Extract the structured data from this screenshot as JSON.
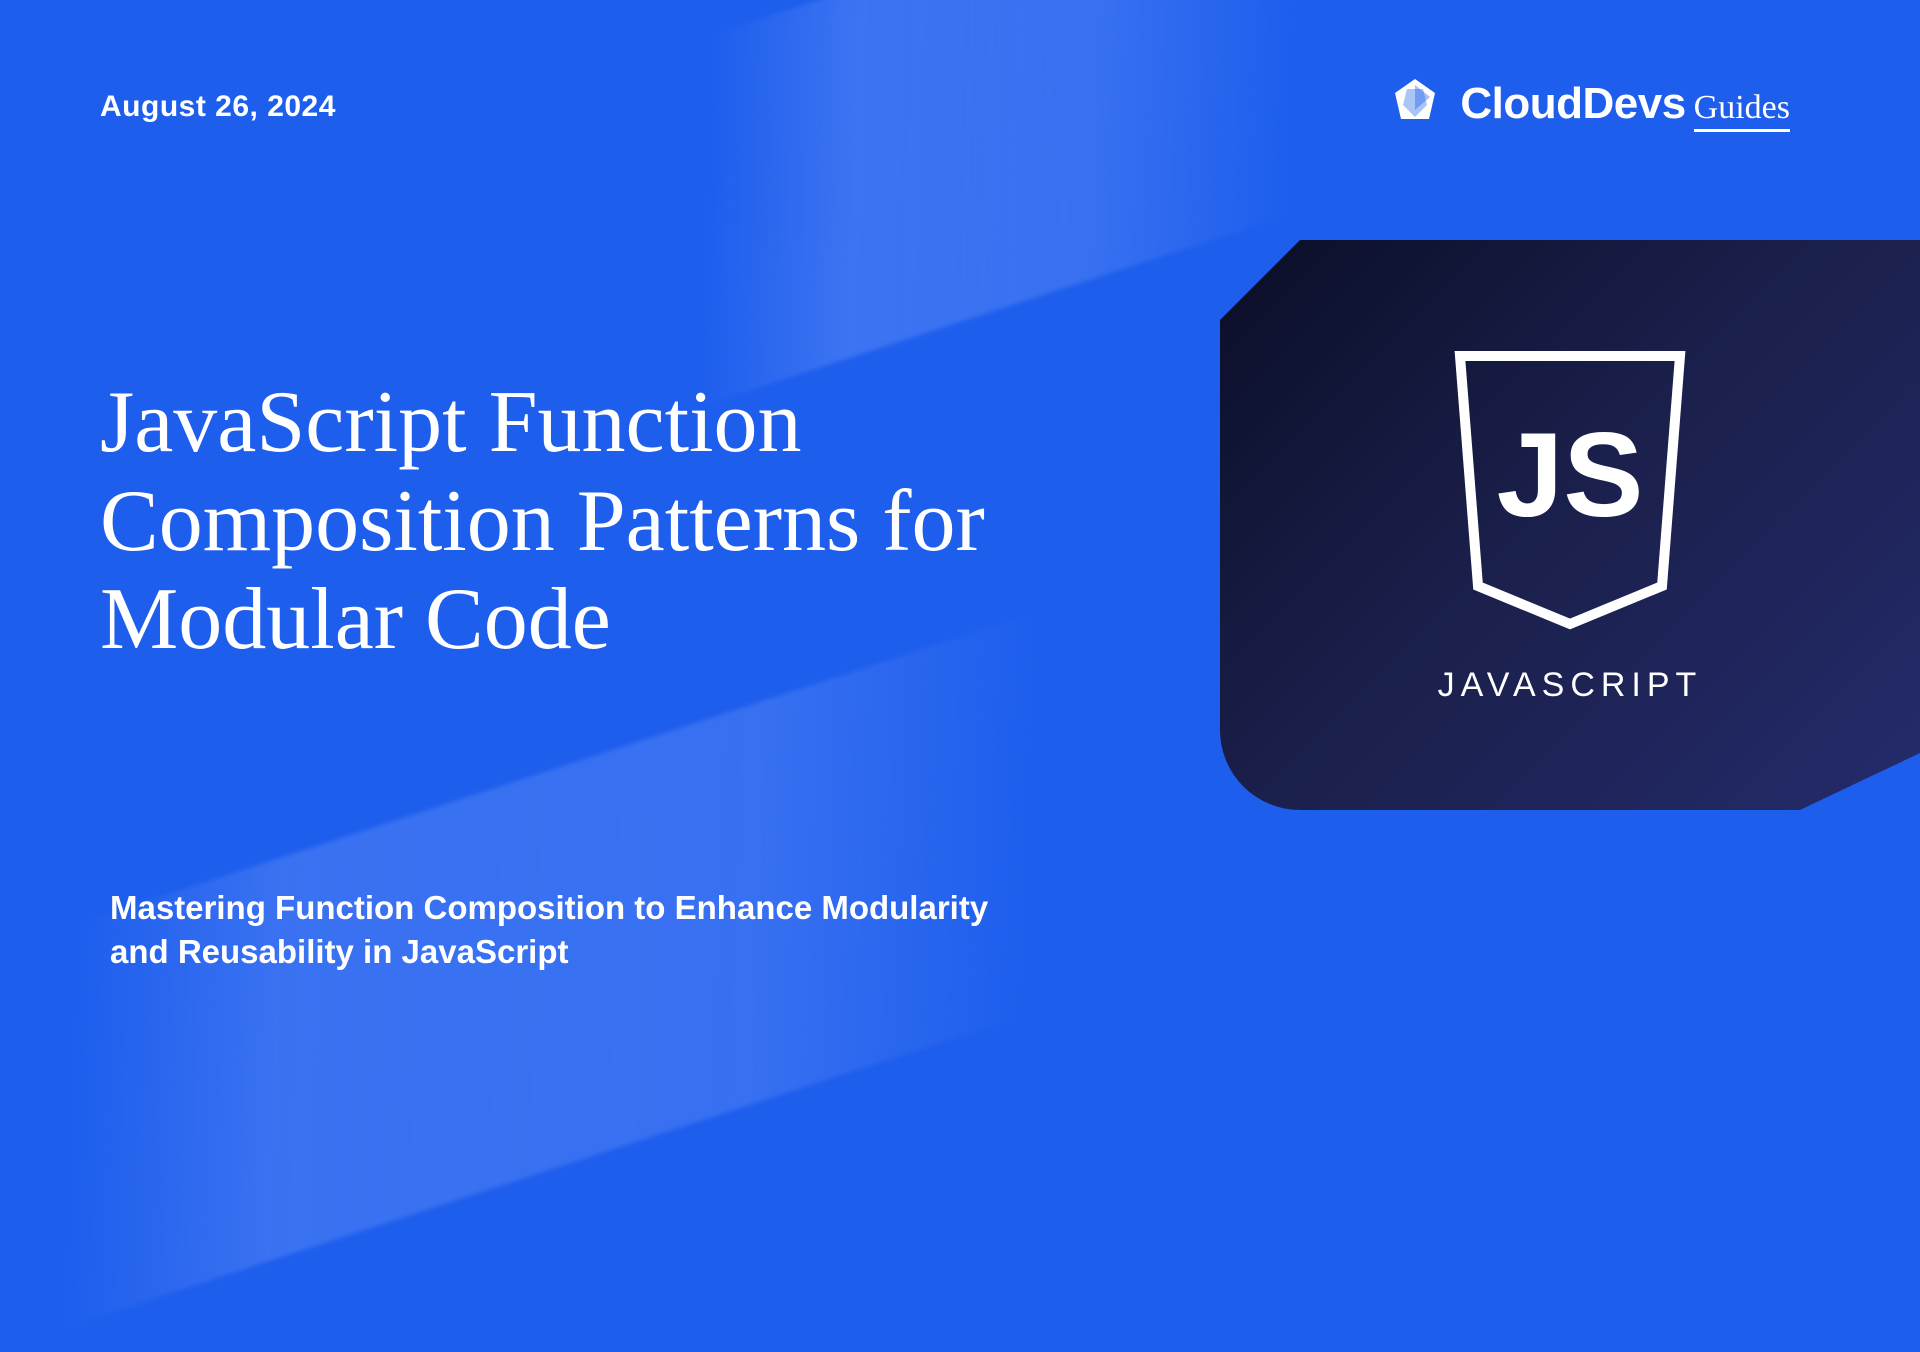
{
  "date": "August 26,  2024",
  "brand": {
    "name": "CloudDevs",
    "suffix": "Guides"
  },
  "title": "JavaScript Function Composition Patterns for Modular Code",
  "subtitle": "Mastering Function Composition to Enhance Modularity and Reusability in JavaScript",
  "card": {
    "label": "JAVASCRIPT",
    "shield_text": "JS"
  }
}
